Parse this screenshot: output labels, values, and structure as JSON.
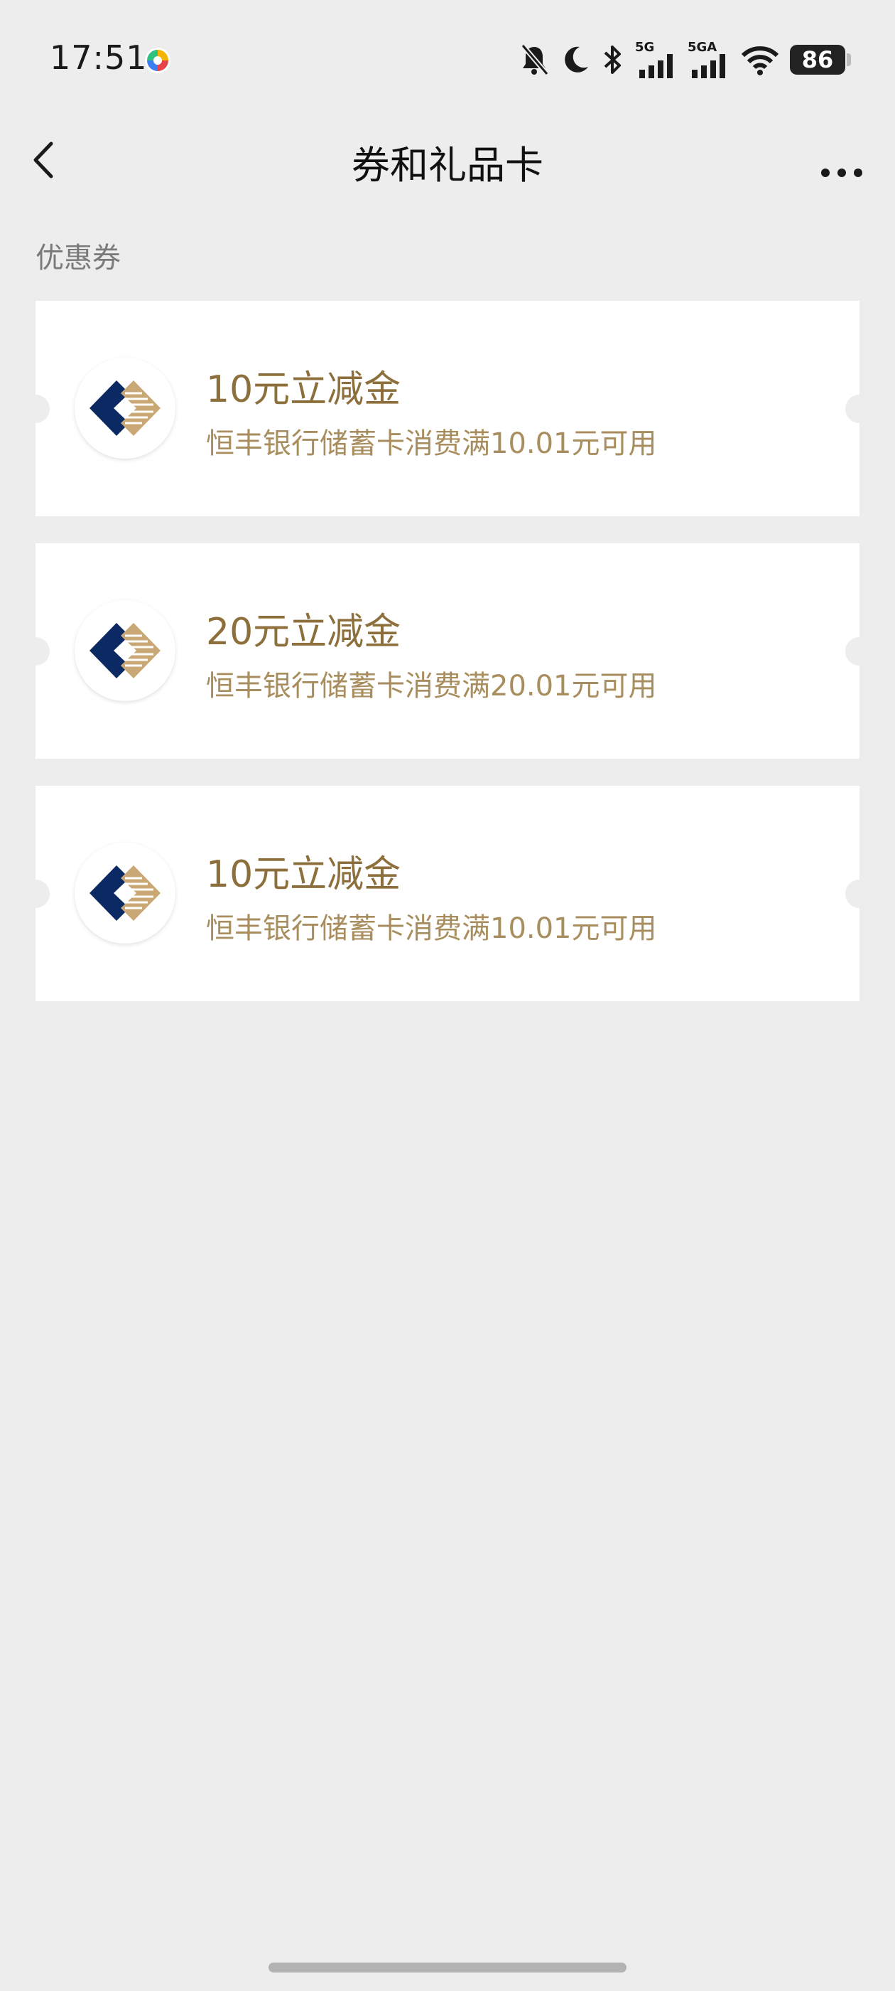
{
  "status_bar": {
    "time": "17:51",
    "network_1": "5G",
    "network_2": "5GA",
    "battery": "86",
    "icons": [
      "app-icon",
      "mute-bell-icon",
      "moon-icon",
      "bluetooth-icon",
      "signal-icon",
      "signal-icon",
      "wifi-icon",
      "battery-icon"
    ]
  },
  "nav": {
    "title": "券和礼品卡",
    "back_icon": "chevron-left-icon",
    "more_icon": "more-dots-icon"
  },
  "section": {
    "label": "优惠券"
  },
  "coupons": [
    {
      "title": "10元立减金",
      "description": "恒丰银行储蓄卡消费满10.01元可用",
      "logo": "bank-logo-icon"
    },
    {
      "title": "20元立减金",
      "description": "恒丰银行储蓄卡消费满20.01元可用",
      "logo": "bank-logo-icon"
    },
    {
      "title": "10元立减金",
      "description": "恒丰银行储蓄卡消费满10.01元可用",
      "logo": "bank-logo-icon"
    }
  ],
  "colors": {
    "background": "#ededed",
    "card": "#ffffff",
    "title_gold": "#8c6f3a",
    "desc_gold": "#a88e5e",
    "logo_navy": "#0b2a63",
    "logo_gold": "#c9a875"
  }
}
